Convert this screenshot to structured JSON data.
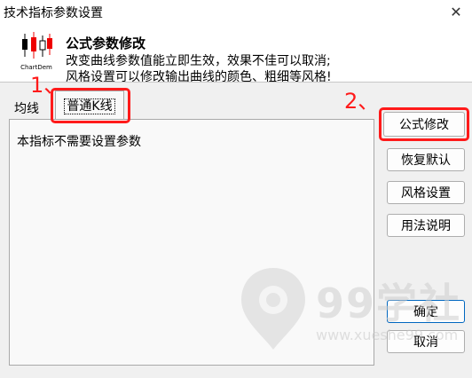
{
  "window": {
    "title": "技术指标参数设置",
    "close_symbol": "✕"
  },
  "header": {
    "logo_text": "ChartDem",
    "title": "公式参数修改",
    "line1": "改变曲线参数值能立即生效，效果不佳可以取消;",
    "line2": "风格设置可以修改输出曲线的颜色、粗细等风格!"
  },
  "tabs": [
    {
      "label": "均线"
    },
    {
      "label": "普通K线"
    }
  ],
  "panel": {
    "message": "本指标不需要设置参数"
  },
  "buttons": {
    "formula": "公式修改",
    "restore": "恢复默认",
    "style": "风格设置",
    "help": "用法说明",
    "ok": "确定",
    "cancel": "取消"
  },
  "annotations": {
    "step1": "1、",
    "step2": "2、"
  },
  "watermark": {
    "brand": "99学社",
    "url": "www.xueshe99.com"
  },
  "colors": {
    "highlight": "#ff1a1a",
    "accent": "#0067c0"
  }
}
